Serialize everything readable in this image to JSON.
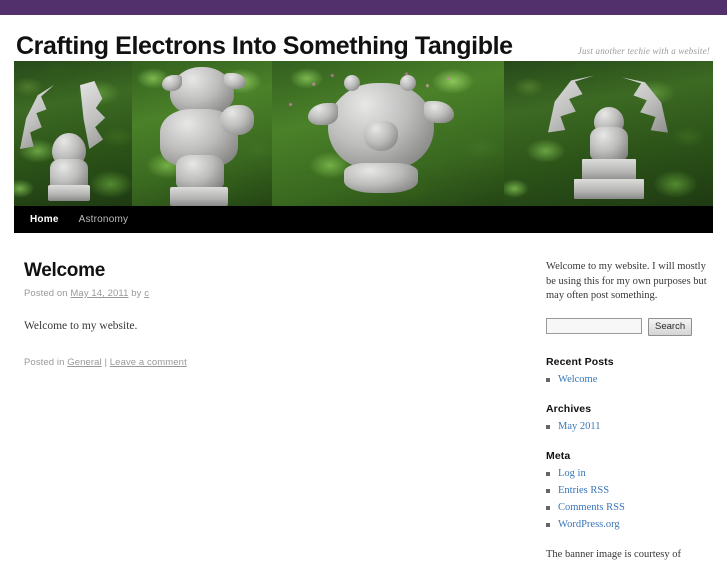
{
  "admin_bar": {
    "color": "#51306b"
  },
  "header": {
    "site_title": "Crafting Electrons Into Something Tangible",
    "tagline": "Just another techie with a website!"
  },
  "banner": {
    "alt": "Four gargoyle statues photographed in a garden",
    "panels": [
      {
        "name": "winged-gargoyle-left"
      },
      {
        "name": "crouching-gargoyle"
      },
      {
        "name": "big-face-gargoyle"
      },
      {
        "name": "winged-gargoyle-pedestal"
      }
    ]
  },
  "nav": {
    "items": [
      {
        "label": "Home",
        "active": true
      },
      {
        "label": "Astronomy",
        "active": false
      }
    ]
  },
  "post": {
    "title": "Welcome",
    "meta_prefix": "Posted on ",
    "date": "May 14, 2011",
    "meta_by": " by ",
    "author": "c",
    "body": "Welcome to my website.",
    "footer_prefix": "Posted in ",
    "category": "General",
    "footer_sep": " | ",
    "comment_link": "Leave a comment"
  },
  "sidebar": {
    "intro": "Welcome to my website. I will mostly be using this for my own purposes but may often post something.",
    "search": {
      "value": "",
      "placeholder": "",
      "button_label": "Search"
    },
    "widgets": [
      {
        "title": "Recent Posts",
        "items": [
          {
            "label": "Welcome"
          }
        ]
      },
      {
        "title": "Archives",
        "items": [
          {
            "label": "May 2011"
          }
        ]
      },
      {
        "title": "Meta",
        "items": [
          {
            "label": "Log in"
          },
          {
            "label": "Entries RSS"
          },
          {
            "label": "Comments RSS"
          },
          {
            "label": "WordPress.org"
          }
        ]
      }
    ],
    "footnote": "The banner image is courtesy of",
    "link_color": "#3a76b8"
  }
}
